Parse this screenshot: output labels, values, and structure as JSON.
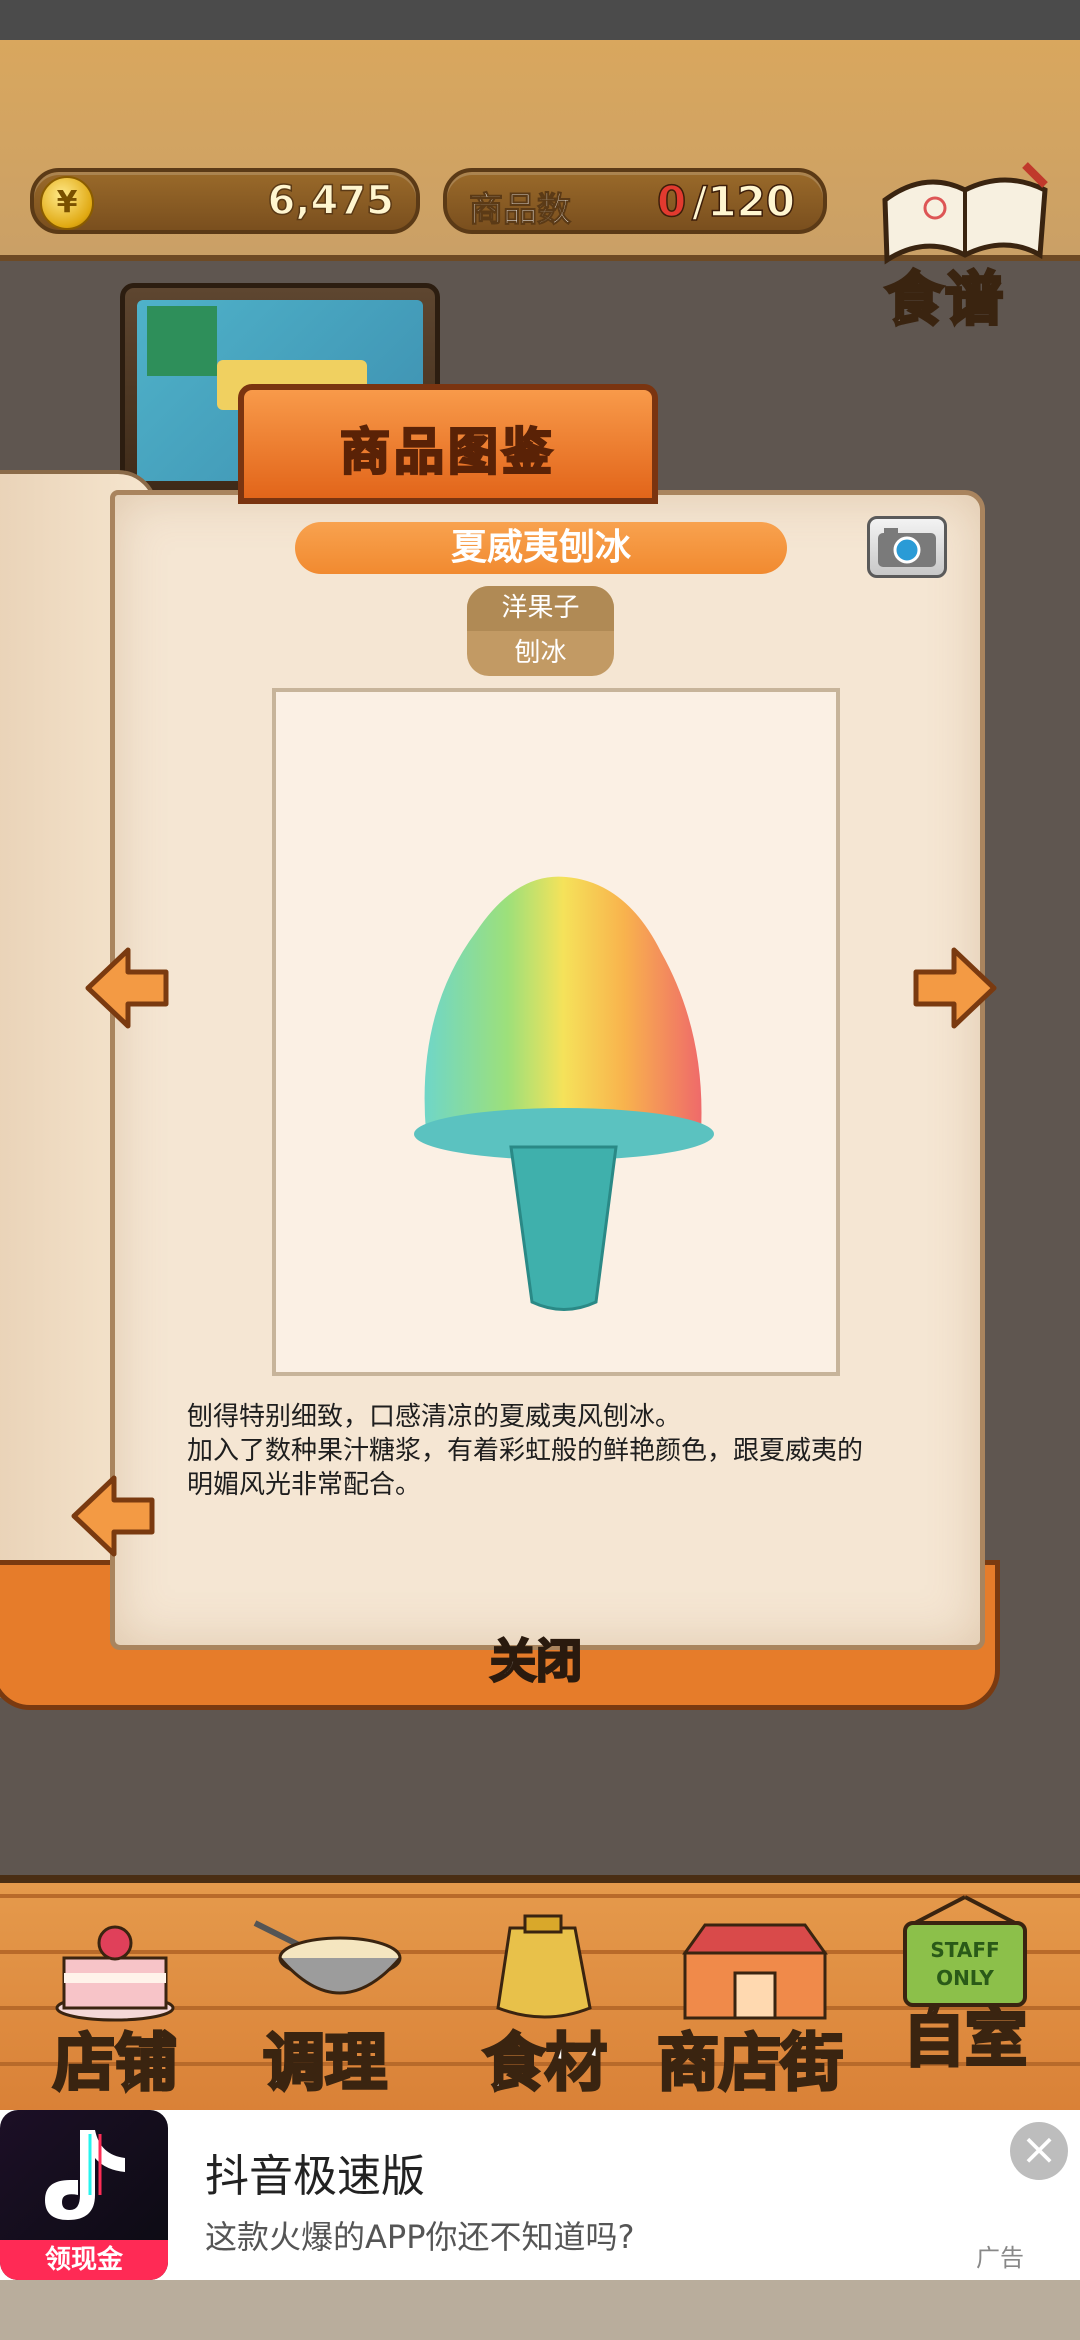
{
  "header": {
    "coin_icon": "yen-coin-icon",
    "coin_symbol": "¥",
    "coins": "6,475",
    "product_count_label": "商品数",
    "product_count_current": "0",
    "product_count_total": "/120",
    "recipe_label": "食谱"
  },
  "book": {
    "tab_title": "商品图鉴",
    "product_name": "夏威夷刨冰",
    "category_top": "洋果子",
    "category_bottom": "刨冰",
    "description_lines": [
      "刨得特别细致，口感清凉的夏威夷风刨冰。",
      "加入了数种果汁糖浆，有着彩虹般的鲜艳颜色，跟夏威夷的",
      "明媚风光非常配合。"
    ],
    "close_label": "关闭"
  },
  "bottom_nav": {
    "items": [
      {
        "label": "店铺",
        "icon": "cake-icon"
      },
      {
        "label": "调理",
        "icon": "mixing-bowl-icon"
      },
      {
        "label": "食材",
        "icon": "flour-sack-icon"
      },
      {
        "label": "商店街",
        "icon": "shop-street-icon"
      },
      {
        "label": "自室",
        "icon": "staff-only-sign-icon"
      }
    ],
    "staff_sign_text": "STAFF ONLY"
  },
  "ad": {
    "title": "抖音极速版",
    "subtitle": "这款火爆的APP你还不知道吗?",
    "logo_badge": "领现金",
    "tag": "广告"
  },
  "colors": {
    "accent_orange": "#f18a30",
    "header_brown": "#7a4f1e",
    "page_cream": "#f5e6d3",
    "count_red": "#e23a2f"
  }
}
